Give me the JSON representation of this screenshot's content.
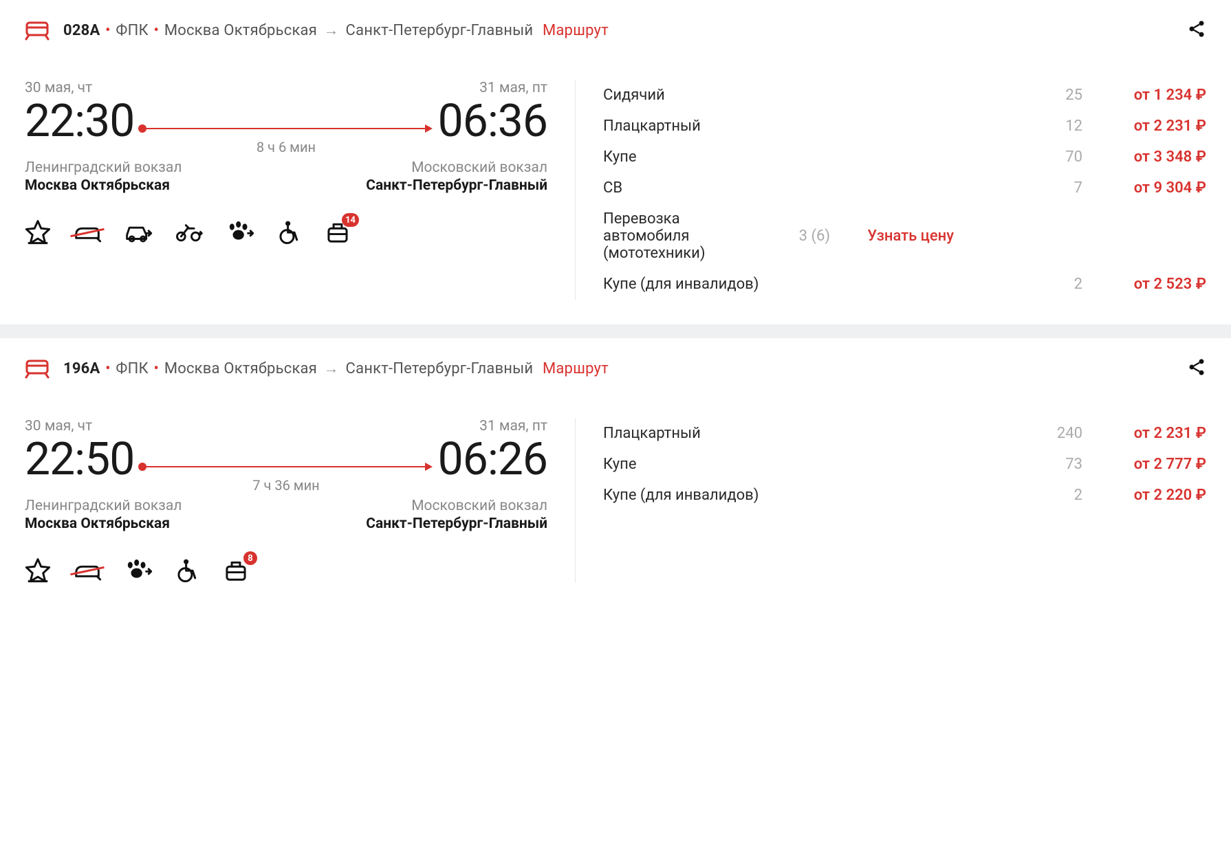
{
  "trains": [
    {
      "number": "028А",
      "carrier": "ФПК",
      "from_station_short": "Москва Октябрьская",
      "to_station_short": "Санкт-Петербург-Главный",
      "route_link": "Маршрут",
      "dep_date": "30 мая, чт",
      "dep_time": "22:30",
      "arr_date": "31 мая, пт",
      "arr_time": "06:36",
      "duration": "8 ч 6 мин",
      "dep_vokzal": "Ленинградский вокзал",
      "dep_city": "Москва Октябрьская",
      "arr_vokzal": "Московский вокзал",
      "arr_city": "Санкт-Петербург-Главный",
      "amenity_badge": "14",
      "prices": [
        {
          "class": "Сидячий",
          "count": "25",
          "price": "от 1 234 ₽"
        },
        {
          "class": "Плацкартный",
          "count": "12",
          "price": "от 2 231 ₽"
        },
        {
          "class": "Купе",
          "count": "70",
          "price": "от 3 348 ₽"
        },
        {
          "class": "СВ",
          "count": "7",
          "price": "от 9 304 ₽"
        },
        {
          "class": "Перевозка автомобиля (мототехники)",
          "count": "3 (6)",
          "price_link": "Узнать цену"
        },
        {
          "class": "Купе (для инвалидов)",
          "count": "2",
          "price": "от 2 523 ₽"
        }
      ]
    },
    {
      "number": "196А",
      "carrier": "ФПК",
      "from_station_short": "Москва Октябрьская",
      "to_station_short": "Санкт-Петербург-Главный",
      "route_link": "Маршрут",
      "dep_date": "30 мая, чт",
      "dep_time": "22:50",
      "arr_date": "31 мая, пт",
      "arr_time": "06:26",
      "duration": "7 ч 36 мин",
      "dep_vokzal": "Ленинградский вокзал",
      "dep_city": "Москва Октябрьская",
      "arr_vokzal": "Московский вокзал",
      "arr_city": "Санкт-Петербург-Главный",
      "amenity_badge": "8",
      "prices": [
        {
          "class": "Плацкартный",
          "count": "240",
          "price": "от 2 231 ₽"
        },
        {
          "class": "Купе",
          "count": "73",
          "price": "от 2 777 ₽"
        },
        {
          "class": "Купе (для инвалидов)",
          "count": "2",
          "price": "от 2 220 ₽"
        }
      ]
    }
  ]
}
